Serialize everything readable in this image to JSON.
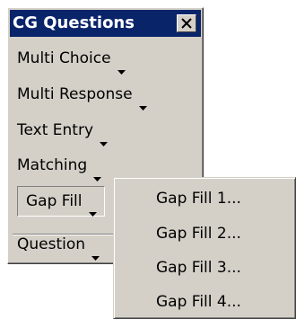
{
  "toolbar": {
    "title": "CG Questions",
    "items": [
      {
        "label": "Multi Choice"
      },
      {
        "label": "Multi Response"
      },
      {
        "label": "Text Entry"
      },
      {
        "label": "Matching"
      },
      {
        "label": "Gap Fill"
      },
      {
        "label": "Question"
      }
    ]
  },
  "menu": {
    "items": [
      {
        "label": "Gap Fill 1..."
      },
      {
        "label": "Gap Fill 2..."
      },
      {
        "label": "Gap Fill 3..."
      },
      {
        "label": "Gap Fill 4..."
      }
    ]
  },
  "colors": {
    "face": "#d4d0c8",
    "titlebar": "#0a246a",
    "title_text": "#ffffff"
  }
}
